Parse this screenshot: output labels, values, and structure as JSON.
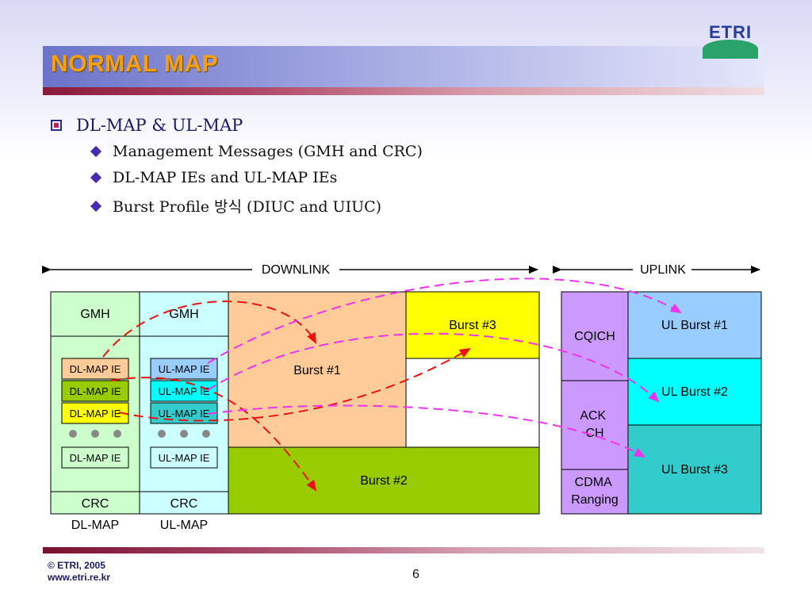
{
  "slide": {
    "title": "NORMAL MAP",
    "logo_text": "ETRI",
    "bullets": {
      "main": "DL-MAP & UL-MAP",
      "sub": [
        "Management Messages (GMH and CRC)",
        "DL-MAP IEs and UL-MAP IEs",
        "Burst Profile 방식 (DIUC and UIUC)"
      ]
    },
    "footer": {
      "copyright": "© ETRI, 2005",
      "url": "www.etri.re.kr",
      "page_number": "6"
    }
  },
  "diagram": {
    "downlink_label": "DOWNLINK",
    "uplink_label": "UPLINK",
    "dl_map": {
      "header": "GMH",
      "ies": [
        "DL-MAP IE",
        "DL-MAP IE",
        "DL-MAP IE",
        "DL-MAP IE"
      ],
      "footer": "CRC",
      "caption": "DL-MAP"
    },
    "ul_map": {
      "header": "GMH",
      "ies": [
        "UL-MAP IE",
        "UL-MAP IE",
        "UL-MAP IE",
        "UL-MAP IE"
      ],
      "footer": "CRC",
      "caption": "UL-MAP"
    },
    "dl_bursts": [
      "Burst #1",
      "Burst #2",
      "Burst #3"
    ],
    "ul_control": [
      "CQICH",
      "ACK\nCH",
      "CDMA\nRanging"
    ],
    "ul_bursts": [
      "UL Burst #1",
      "UL Burst #2",
      "UL Burst #3"
    ],
    "colors": {
      "dl_map_bg": "#ccffcc",
      "ul_map_bg": "#ccffff",
      "burst1": "#ffcc99",
      "burst2": "#99cc00",
      "burst3": "#ffff00",
      "ul_control": "#cc99ff",
      "ul_burst1": "#99ccff",
      "ul_burst2": "#00ffff",
      "ul_burst3": "#33cccc",
      "dl_arrow": "#ee1111",
      "ul_arrow": "#ee33ee"
    }
  }
}
